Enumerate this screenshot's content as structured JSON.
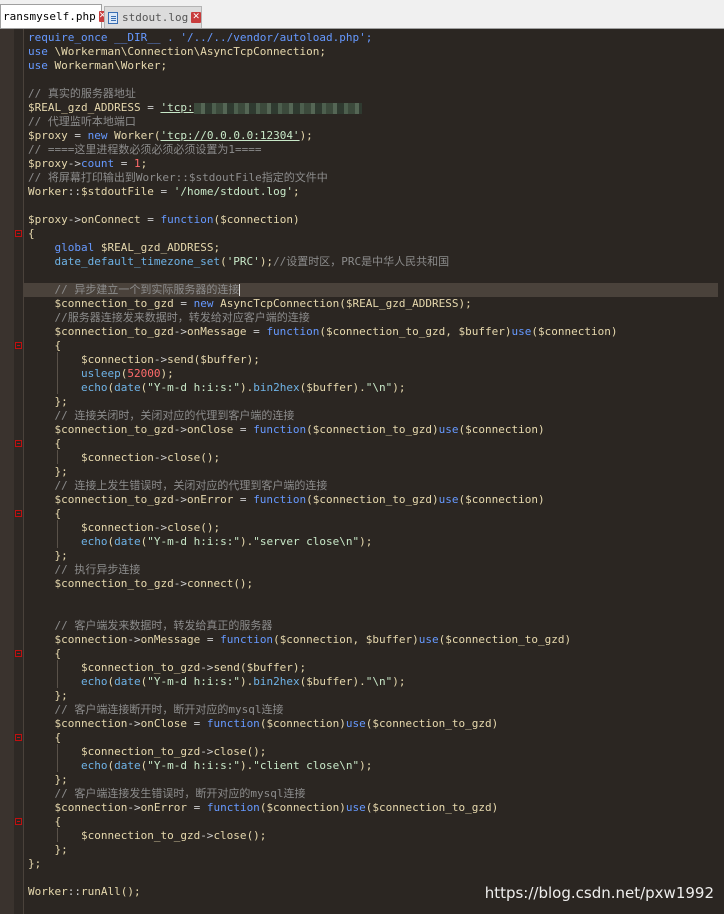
{
  "tabs": [
    {
      "label": "ransmyself.php",
      "active": true
    },
    {
      "label": "stdout.log",
      "active": false
    }
  ],
  "code": {
    "l1": "require_once __DIR__ . '/../../vendor/autoload.php';",
    "l2a": "use",
    "l2b": " \\Workerman\\Connection\\AsyncTcpConnection;",
    "l3a": "use",
    "l3b": " Workerman\\Worker;",
    "l5": "// 真实的服务器地址",
    "l6a": "$REAL_gzd_ADDRESS",
    "l6b": " = ",
    "l6c": "'tcp:",
    "l7": "// 代理监听本地端口",
    "l8a": "$proxy",
    "l8b": " = ",
    "l8c": "new",
    "l8d": " Worker(",
    "l8e": "'tcp://0.0.0.0:12304'",
    "l8f": ");",
    "l9": "// ====这里进程数必须必须必须设置为1====",
    "l10a": "$proxy",
    "l10b": "->",
    "l10c": "count",
    "l10d": " = ",
    "l10e": "1",
    "l10f": ";",
    "l11": "// 将屏幕打印输出到Worker::$stdoutFile指定的文件中",
    "l12a": "Worker",
    "l12b": "::",
    "l12c": "$stdoutFile",
    "l12d": " = ",
    "l12e": "'/home/stdout.log'",
    "l12f": ";",
    "l14a": "$proxy",
    "l14b": "->",
    "l14c": "onConnect",
    "l14d": " = ",
    "l14e": "function",
    "l14f": "(",
    "l14g": "$connection",
    "l14h": ")",
    "l15": "{",
    "l16a": "    global ",
    "l16b": "$REAL_gzd_ADDRESS",
    "l16c": ";",
    "l17a": "    date_default_timezone_set",
    "l17b": "(",
    "l17c": "'PRC'",
    "l17d": ");",
    "l17e": "//设置时区，PRC是中华人民共和国",
    "l19": "    // 异步建立一个到实际服务器的连接",
    "l20a": "    $connection_to_gzd",
    "l20b": " = ",
    "l20c": "new",
    "l20d": " AsyncTcpConnection(",
    "l20e": "$REAL_gzd_ADDRESS",
    "l20f": ");",
    "l21": "    //服务器连接发来数据时，转发给对应客户端的连接",
    "l22a": "    $connection_to_gzd",
    "l22b": "->",
    "l22c": "onMessage",
    "l22d": " = ",
    "l22e": "function",
    "l22f": "(",
    "l22g": "$connection_to_gzd",
    "l22h": ", ",
    "l22i": "$buffer",
    "l22j": ")",
    "l22k": "use",
    "l22l": "(",
    "l22m": "$connection",
    "l22n": ")",
    "l23": "    {",
    "l24a": "        $connection",
    "l24b": "->",
    "l24c": "send",
    "l24d": "(",
    "l24e": "$buffer",
    "l24f": ");",
    "l25a": "        usleep",
    "l25b": "(",
    "l25c": "52000",
    "l25d": ");",
    "l26a": "        echo",
    "l26b": "(",
    "l26c": "date",
    "l26d": "(",
    "l26e": "\"Y-m-d h:i:s:\"",
    "l26f": ").",
    "l26g": "bin2hex",
    "l26h": "(",
    "l26i": "$buffer",
    "l26j": ").",
    "l26k": "\"\\n\"",
    "l26l": ");",
    "l27": "    };",
    "l28": "    // 连接关闭时，关闭对应的代理到客户端的连接",
    "l29a": "    $connection_to_gzd",
    "l29b": "->",
    "l29c": "onClose",
    "l29d": " = ",
    "l29e": "function",
    "l29f": "(",
    "l29g": "$connection_to_gzd",
    "l29h": ")",
    "l29i": "use",
    "l29j": "(",
    "l29k": "$connection",
    "l29l": ")",
    "l30": "    {",
    "l31a": "        $connection",
    "l31b": "->",
    "l31c": "close",
    "l31d": "();",
    "l32": "    };",
    "l33": "    // 连接上发生错误时，关闭对应的代理到客户端的连接",
    "l34a": "    $connection_to_gzd",
    "l34b": "->",
    "l34c": "onError",
    "l34d": " = ",
    "l34e": "function",
    "l34f": "(",
    "l34g": "$connection_to_gzd",
    "l34h": ")",
    "l34i": "use",
    "l34j": "(",
    "l34k": "$connection",
    "l34l": ")",
    "l35": "    {",
    "l36a": "        $connection",
    "l36b": "->",
    "l36c": "close",
    "l36d": "();",
    "l37a": "        echo",
    "l37b": "(",
    "l37c": "date",
    "l37d": "(",
    "l37e": "\"Y-m-d h:i:s:\"",
    "l37f": ").",
    "l37g": "\"server close\\n\"",
    "l37h": ");",
    "l38": "    };",
    "l39": "    // 执行异步连接",
    "l40a": "    $connection_to_gzd",
    "l40b": "->",
    "l40c": "connect",
    "l40d": "();",
    "l43": "    // 客户端发来数据时，转发给真正的服务器",
    "l44a": "    $connection",
    "l44b": "->",
    "l44c": "onMessage",
    "l44d": " = ",
    "l44e": "function",
    "l44f": "(",
    "l44g": "$connection",
    "l44h": ", ",
    "l44i": "$buffer",
    "l44j": ")",
    "l44k": "use",
    "l44l": "(",
    "l44m": "$connection_to_gzd",
    "l44n": ")",
    "l45": "    {",
    "l46a": "        $connection_to_gzd",
    "l46b": "->",
    "l46c": "send",
    "l46d": "(",
    "l46e": "$buffer",
    "l46f": ");",
    "l47a": "        echo",
    "l47b": "(",
    "l47c": "date",
    "l47d": "(",
    "l47e": "\"Y-m-d h:i:s:\"",
    "l47f": ").",
    "l47g": "bin2hex",
    "l47h": "(",
    "l47i": "$buffer",
    "l47j": ").",
    "l47k": "\"\\n\"",
    "l47l": ");",
    "l48": "    };",
    "l49": "    // 客户端连接断开时，断开对应的mysql连接",
    "l50a": "    $connection",
    "l50b": "->",
    "l50c": "onClose",
    "l50d": " = ",
    "l50e": "function",
    "l50f": "(",
    "l50g": "$connection",
    "l50h": ")",
    "l50i": "use",
    "l50j": "(",
    "l50k": "$connection_to_gzd",
    "l50l": ")",
    "l51": "    {",
    "l52a": "        $connection_to_gzd",
    "l52b": "->",
    "l52c": "close",
    "l52d": "();",
    "l53a": "        echo",
    "l53b": "(",
    "l53c": "date",
    "l53d": "(",
    "l53e": "\"Y-m-d h:i:s:\"",
    "l53f": ").",
    "l53g": "\"client close\\n\"",
    "l53h": ");",
    "l54": "    };",
    "l55": "    // 客户端连接发生错误时，断开对应的mysql连接",
    "l56a": "    $connection",
    "l56b": "->",
    "l56c": "onError",
    "l56d": " = ",
    "l56e": "function",
    "l56f": "(",
    "l56g": "$connection",
    "l56h": ")",
    "l56i": "use",
    "l56j": "(",
    "l56k": "$connection_to_gzd",
    "l56l": ")",
    "l57": "    {",
    "l58a": "        $connection_to_gzd",
    "l58b": "->",
    "l58c": "close",
    "l58d": "();",
    "l59": "    };",
    "l60": "};",
    "l62a": "Worker",
    "l62b": "::",
    "l62c": "runAll",
    "l62d": "();"
  },
  "watermark": "https://blog.csdn.net/pxw1992",
  "colors": {
    "background": "#2b2622",
    "keyword": "#6699ff",
    "variable": "#e6d8ad",
    "string": "#c8e8c8",
    "comment": "#8c8c8c",
    "number": "#ff6b6b",
    "fold_marker": "#c01010"
  }
}
